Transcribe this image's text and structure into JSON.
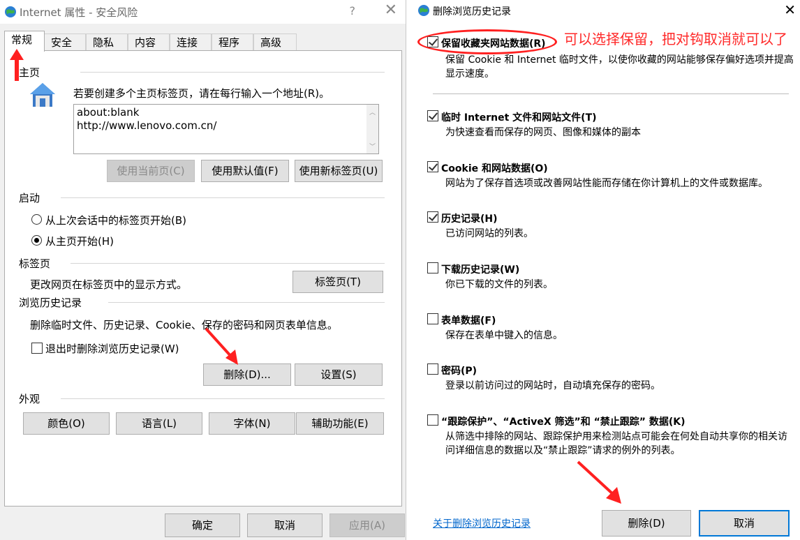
{
  "left": {
    "title": "Internet 属性 - 安全风险",
    "help": "?",
    "close": "✕",
    "tabs": [
      "常规",
      "安全",
      "隐私",
      "内容",
      "连接",
      "程序",
      "高级"
    ],
    "home": {
      "heading": "主页",
      "instruction": "若要创建多个主页标签页，请在每行输入一个地址(R)。",
      "urls": "about:blank\nhttp://www.lenovo.com.cn/",
      "btn_current": "使用当前页(C)",
      "btn_default": "使用默认值(F)",
      "btn_newtab": "使用新标签页(U)"
    },
    "startup": {
      "heading": "启动",
      "opt1": "从上次会话中的标签页开始(B)",
      "opt2": "从主页开始(H)",
      "selected": 2
    },
    "tabs_section": {
      "heading": "标签页",
      "desc": "更改网页在标签页中的显示方式。",
      "btn": "标签页(T)"
    },
    "history": {
      "heading": "浏览历史记录",
      "desc": "删除临时文件、历史记录、Cookie、保存的密码和网页表单信息。",
      "checkbox": "退出时删除浏览历史记录(W)",
      "btn_delete": "删除(D)...",
      "btn_settings": "设置(S)"
    },
    "appearance": {
      "heading": "外观",
      "btn_colors": "颜色(O)",
      "btn_language": "语言(L)",
      "btn_fonts": "字体(N)",
      "btn_access": "辅助功能(E)"
    },
    "footer": {
      "ok": "确定",
      "cancel": "取消",
      "apply": "应用(A)"
    }
  },
  "right": {
    "title": "删除浏览历史记录",
    "close": "✕",
    "annotation": "可以选择保留，把对钩取消就可以了",
    "options": [
      {
        "title": "保留收藏夹网站数据(R)",
        "desc": "保留 Cookie 和 Internet 临时文件，以使你收藏的网站能够保存偏好选项并提高显示速度。",
        "checked": true
      },
      {
        "title": "临时 Internet 文件和网站文件(T)",
        "desc": "为快速查看而保存的网页、图像和媒体的副本",
        "checked": true
      },
      {
        "title": "Cookie 和网站数据(O)",
        "desc": "网站为了保存首选项或改善网站性能而存储在你计算机上的文件或数据库。",
        "checked": true
      },
      {
        "title": "历史记录(H)",
        "desc": "已访问网站的列表。",
        "checked": true
      },
      {
        "title": "下载历史记录(W)",
        "desc": "你已下载的文件的列表。",
        "checked": false
      },
      {
        "title": "表单数据(F)",
        "desc": "保存在表单中键入的信息。",
        "checked": false
      },
      {
        "title": "密码(P)",
        "desc": "登录以前访问过的网站时，自动填充保存的密码。",
        "checked": false
      },
      {
        "title": "“跟踪保护”、“ActiveX 筛选”和 “禁止跟踪” 数据(K)",
        "desc": "从筛选中排除的网站、跟踪保护用来检测站点可能会在何处自动共享你的相关访问详细信息的数据以及“禁止跟踪”请求的例外的列表。",
        "checked": false
      }
    ],
    "link": "关于删除浏览历史记录",
    "btn_delete": "删除(D)",
    "btn_cancel": "取消"
  },
  "colors": {
    "accent": "#ff2020",
    "link": "#0066cc"
  }
}
